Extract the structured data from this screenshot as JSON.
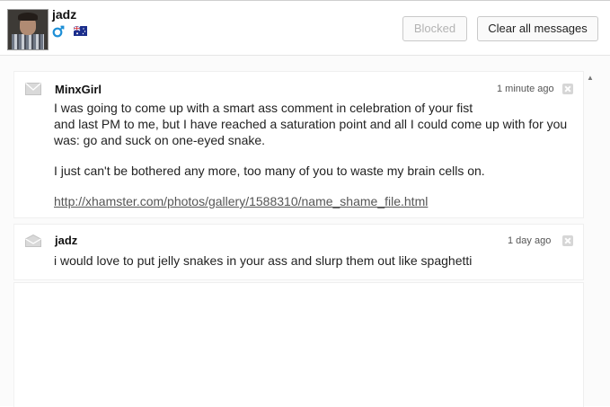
{
  "header": {
    "username": "jadz",
    "gender_icon": "male-symbol-icon",
    "flag_icon": "australia-flag-icon",
    "blocked_label": "Blocked",
    "clear_label": "Clear all messages"
  },
  "messages": [
    {
      "sender": "MinxGirl",
      "time": "1 minute ago",
      "icon": "envelope-icon",
      "lines": [
        "I was going to come up with a smart ass comment in celebration of your fist",
        "and last PM to me, but I have reached a saturation point and all I could come up with for you",
        "was: go and suck on one-eyed snake."
      ],
      "paragraph2": "I just can't be bothered any more, too many of you to waste my brain cells on.",
      "link": "http://xhamster.com/photos/gallery/1588310/name_shame_file.html"
    },
    {
      "sender": "jadz",
      "time": "1 day ago",
      "icon": "envelope-open-icon",
      "lines": [
        "i would love to put jelly snakes in your ass and slurp them out like spaghetti"
      ]
    }
  ],
  "colors": {
    "link": "#555555",
    "muted_button_text": "#b3b3b3"
  }
}
